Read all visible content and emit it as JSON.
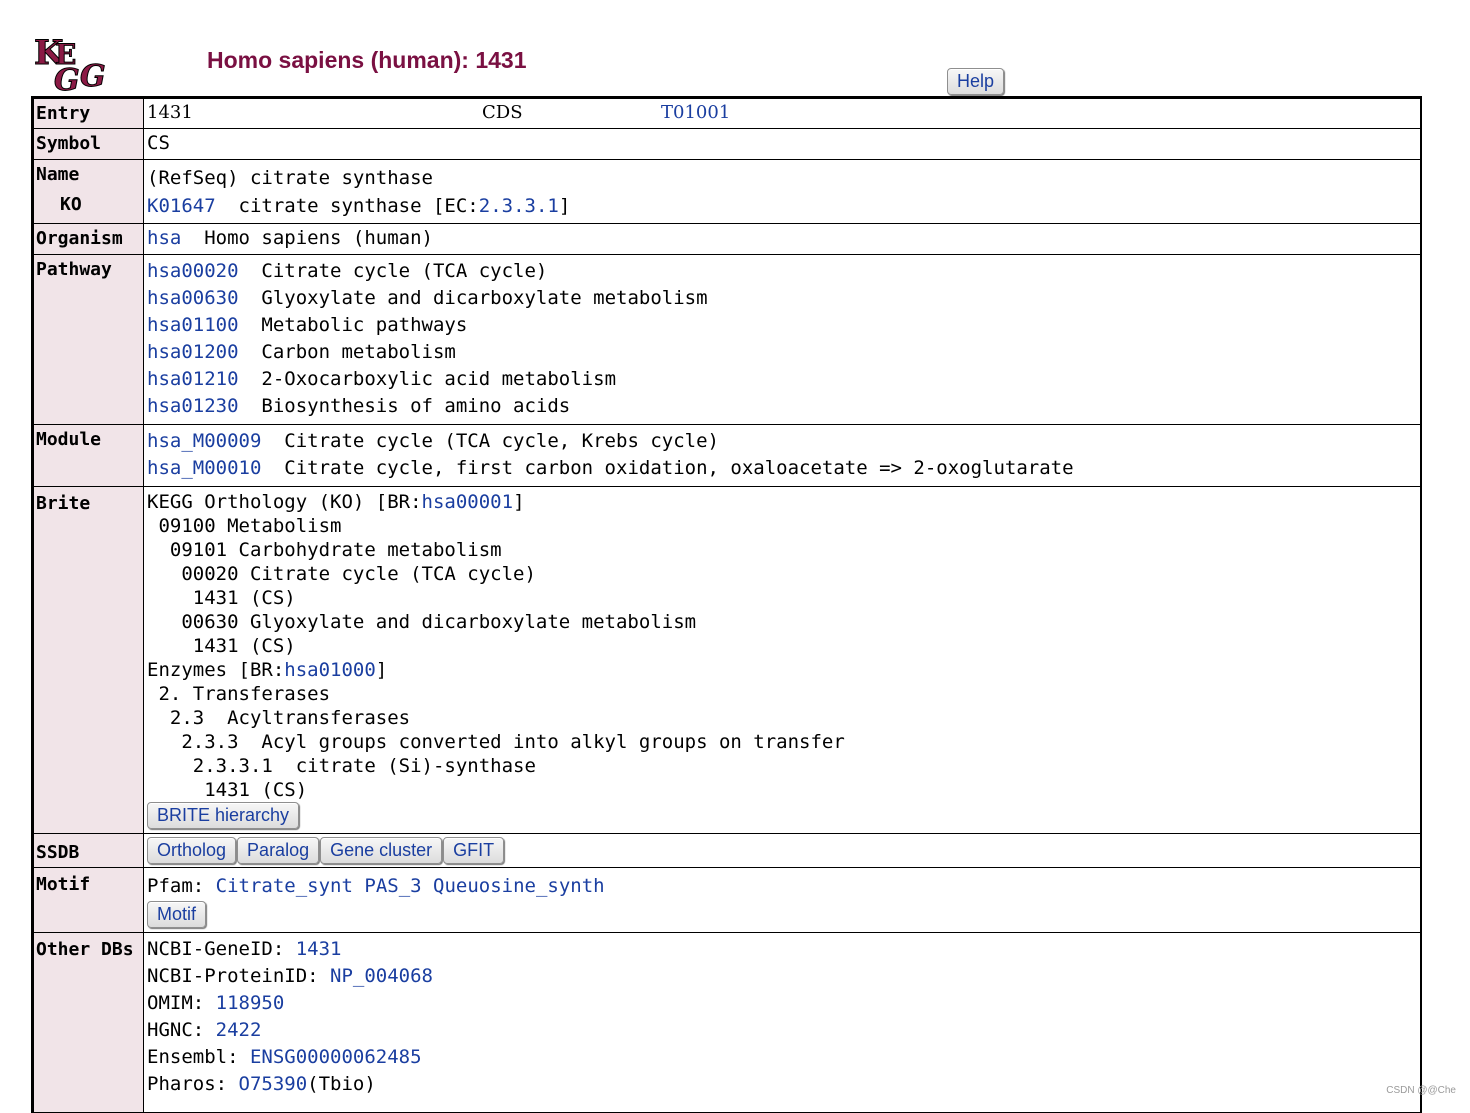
{
  "logo_text": "KEGG",
  "page_title": "Homo sapiens (human): 1431",
  "help_label": "Help",
  "entry": {
    "label": "Entry",
    "id": "1431",
    "type": "CDS",
    "genome": "T01001"
  },
  "symbol": {
    "label": "Symbol",
    "value": "CS"
  },
  "name": {
    "label": "Name",
    "value": "(RefSeq) citrate synthase",
    "ko_label": "KO",
    "ko_id": "K01647",
    "ko_desc_pre": "  citrate synthase [EC:",
    "ec": "2.3.3.1",
    "ko_desc_post": "]"
  },
  "organism": {
    "label": "Organism",
    "code": "hsa",
    "name": "  Homo sapiens (human)"
  },
  "pathway": {
    "label": "Pathway",
    "items": [
      {
        "id": "hsa00020",
        "name": "  Citrate cycle (TCA cycle)"
      },
      {
        "id": "hsa00630",
        "name": "  Glyoxylate and dicarboxylate metabolism"
      },
      {
        "id": "hsa01100",
        "name": "  Metabolic pathways"
      },
      {
        "id": "hsa01200",
        "name": "  Carbon metabolism"
      },
      {
        "id": "hsa01210",
        "name": "  2-Oxocarboxylic acid metabolism"
      },
      {
        "id": "hsa01230",
        "name": "  Biosynthesis of amino acids"
      }
    ]
  },
  "module": {
    "label": "Module",
    "items": [
      {
        "id": "hsa_M00009",
        "name": "  Citrate cycle (TCA cycle, Krebs cycle)"
      },
      {
        "id": "hsa_M00010",
        "name": "  Citrate cycle, first carbon oxidation, oxaloacetate => 2-oxoglutarate"
      }
    ]
  },
  "brite": {
    "label": "Brite",
    "ko_pre": "KEGG Orthology (KO) [BR:",
    "ko_link": "hsa00001",
    "ko_post": "]",
    "lines1": [
      " 09100 Metabolism",
      "  09101 Carbohydrate metabolism",
      "   00020 Citrate cycle (TCA cycle)",
      "    1431 (CS)",
      "   00630 Glyoxylate and dicarboxylate metabolism",
      "    1431 (CS)"
    ],
    "enz_pre": "Enzymes [BR:",
    "enz_link": "hsa01000",
    "enz_post": "]",
    "lines2": [
      " 2. Transferases",
      "  2.3  Acyltransferases",
      "   2.3.3  Acyl groups converted into alkyl groups on transfer",
      "    2.3.3.1  citrate (Si)-synthase",
      "     1431 (CS)"
    ],
    "button": "BRITE hierarchy"
  },
  "ssdb": {
    "label": "SSDB",
    "buttons": [
      "Ortholog",
      "Paralog",
      "Gene cluster",
      "GFIT"
    ]
  },
  "motif": {
    "label": "Motif",
    "pfam_label": "Pfam: ",
    "domains": [
      "Citrate_synt",
      "PAS_3",
      "Queuosine_synth"
    ],
    "button": "Motif"
  },
  "other_dbs": {
    "label": "Other DBs",
    "items": [
      {
        "name": "NCBI-GeneID: ",
        "value": "1431",
        "suffix": ""
      },
      {
        "name": "NCBI-ProteinID: ",
        "value": "NP_004068",
        "suffix": ""
      },
      {
        "name": "OMIM: ",
        "value": "118950",
        "suffix": ""
      },
      {
        "name": "HGNC: ",
        "value": "2422",
        "suffix": ""
      },
      {
        "name": "Ensembl: ",
        "value": "ENSG00000062485",
        "suffix": ""
      },
      {
        "name": "Pharos: ",
        "value": "O75390",
        "suffix": "(Tbio)"
      }
    ]
  },
  "watermark": "CSDN @@Che",
  "colors": {
    "title": "#7a1042",
    "label_bg": "#f1e4e8",
    "link": "#1a3ea0",
    "logo": "#8b1a45"
  }
}
